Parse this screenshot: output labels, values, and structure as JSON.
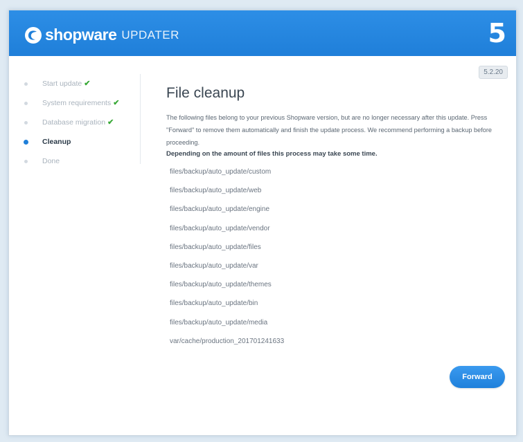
{
  "header": {
    "brand": "shopware",
    "product": "UPDATER",
    "logo_badge": "5"
  },
  "version": "5.2.20",
  "sidebar": {
    "steps": [
      {
        "label": "Start update",
        "done": true
      },
      {
        "label": "System requirements",
        "done": true
      },
      {
        "label": "Database migration",
        "done": true
      },
      {
        "label": "Cleanup",
        "active": true
      },
      {
        "label": "Done"
      }
    ],
    "check_glyph": "✔"
  },
  "main": {
    "title": "File cleanup",
    "description": "The following files belong to your previous Shopware version, but are no longer necessary after this update. Press \"Forward\" to remove them automatically and finish the update process. We recommend performing a backup before proceeding.",
    "note": "Depending on the amount of files this process may take some time.",
    "files": [
      "files/backup/auto_update/custom",
      "files/backup/auto_update/web",
      "files/backup/auto_update/engine",
      "files/backup/auto_update/vendor",
      "files/backup/auto_update/files",
      "files/backup/auto_update/var",
      "files/backup/auto_update/themes",
      "files/backup/auto_update/bin",
      "files/backup/auto_update/media",
      "var/cache/production_201701241633"
    ],
    "forward_label": "Forward"
  },
  "colors": {
    "header": "#1f7fd9",
    "accent": "#1f7fd9",
    "check": "#38a836"
  }
}
